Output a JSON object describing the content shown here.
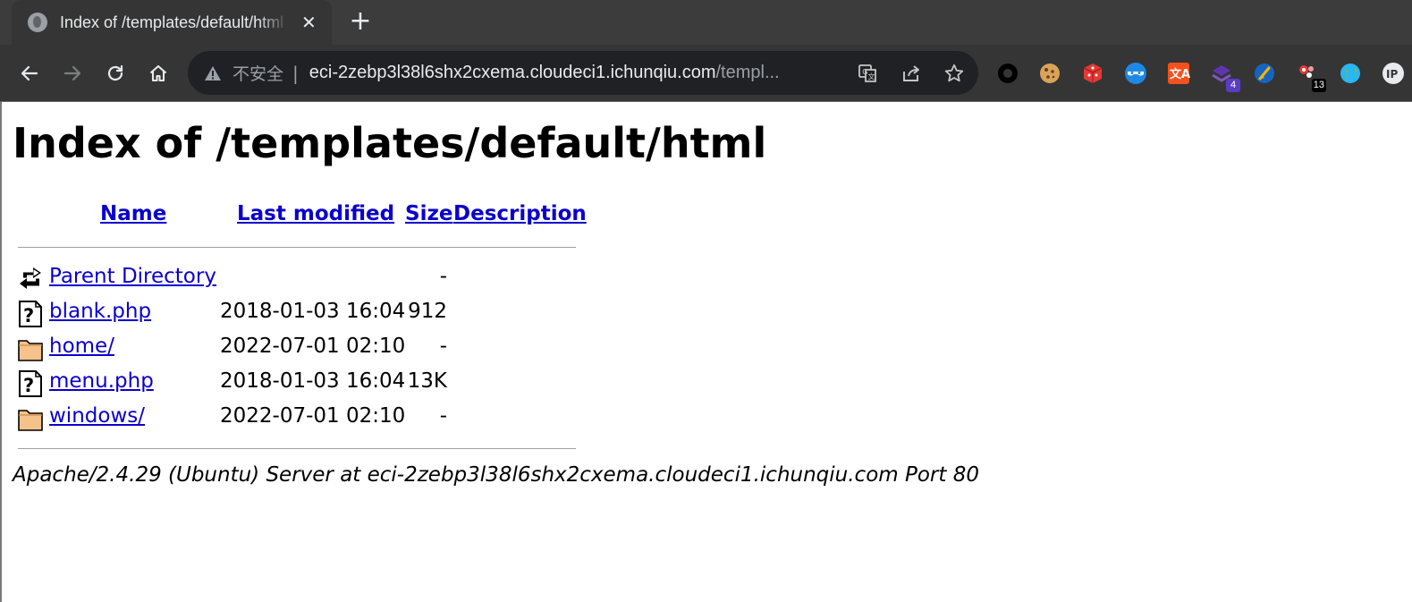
{
  "browser": {
    "tab": {
      "title": "Index of /templates/default/html",
      "close_glyph": "✕"
    },
    "new_tab_glyph": "+",
    "omnibox": {
      "security_label": "不安全",
      "separator": "|",
      "url_host": "eci-2zebp3l38l6shx2cxema.cloudeci1.ichunqiu.com",
      "url_path": "/templ..."
    },
    "nav_icons": [
      "back-arrow-icon",
      "forward-arrow-icon",
      "reload-icon",
      "home-icon"
    ],
    "omnibox_actions": [
      "translate-icon",
      "share-icon",
      "bookmark-star-icon"
    ],
    "extensions": [
      {
        "icon": "black-ring-extension-icon",
        "badge": ""
      },
      {
        "icon": "cookie-extension-icon",
        "badge": ""
      },
      {
        "icon": "red-dice-extension-icon",
        "badge": ""
      },
      {
        "icon": "blue-mask-extension-icon",
        "badge": ""
      },
      {
        "icon": "red-translate-extension-icon",
        "badge": ""
      },
      {
        "icon": "purple-stack-extension-icon",
        "badge": "4"
      },
      {
        "icon": "blue-broom-extension-icon",
        "badge": ""
      },
      {
        "icon": "red-dots-extension-icon",
        "badge": "13"
      },
      {
        "icon": "globe-extension-icon",
        "badge": ""
      },
      {
        "icon": "ip-extension-icon",
        "badge": ""
      }
    ],
    "colors": {
      "tabstrip": "#3c3c3c",
      "toolbar": "#353535",
      "omnibox": "#202124",
      "link": "#0b00cc"
    }
  },
  "page": {
    "heading": "Index of /templates/default/html",
    "columns": {
      "name": "Name",
      "last_modified": "Last modified",
      "size": "Size",
      "description": "Description"
    },
    "rows": [
      {
        "icon": "back-arrow-icon",
        "name": "Parent Directory",
        "modified": "",
        "size": "-"
      },
      {
        "icon": "unknown-file-icon",
        "name": "blank.php",
        "modified": "2018-01-03 16:04",
        "size": "912"
      },
      {
        "icon": "folder-icon",
        "name": "home/",
        "modified": "2022-07-01 02:10",
        "size": "-"
      },
      {
        "icon": "unknown-file-icon",
        "name": "menu.php",
        "modified": "2018-01-03 16:04",
        "size": "13K"
      },
      {
        "icon": "folder-icon",
        "name": "windows/",
        "modified": "2022-07-01 02:10",
        "size": "-"
      }
    ],
    "address": "Apache/2.4.29 (Ubuntu) Server at eci-2zebp3l38l6shx2cxema.cloudeci1.ichunqiu.com Port 80"
  }
}
